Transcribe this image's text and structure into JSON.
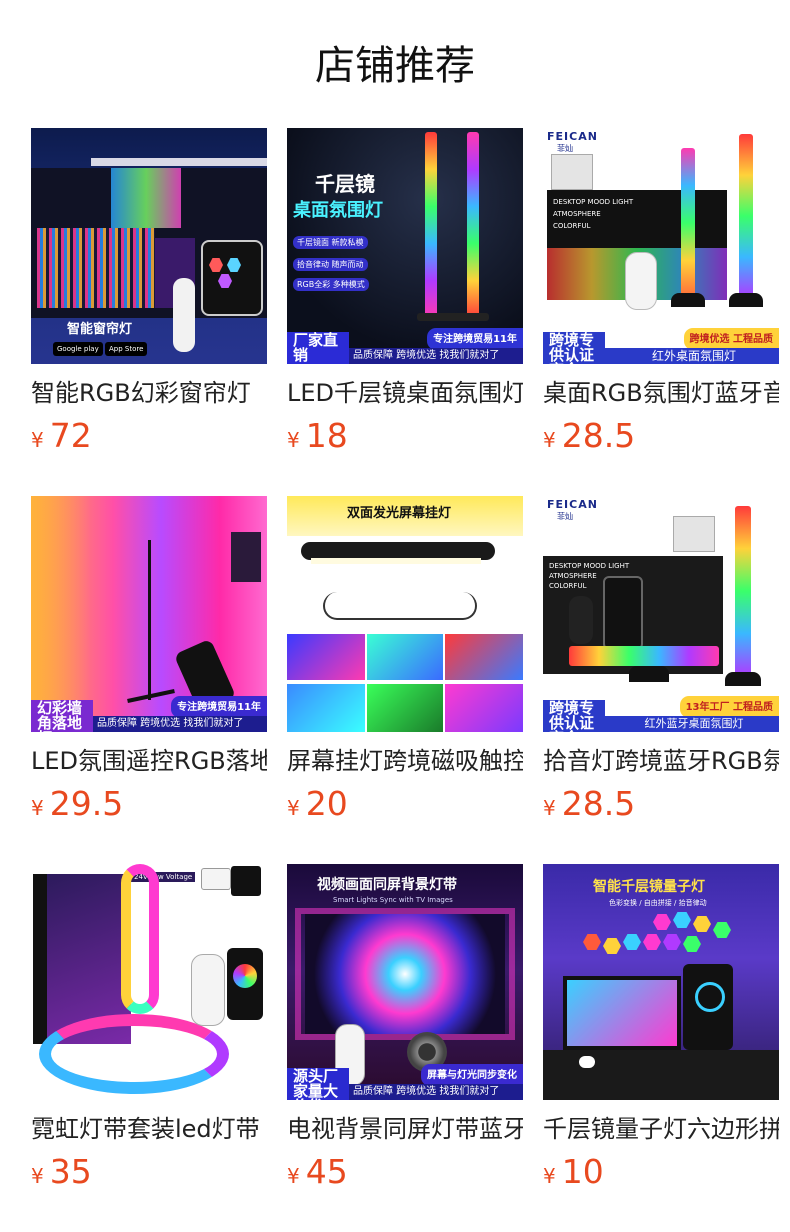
{
  "title": "店铺推荐",
  "currency": "¥",
  "products": [
    {
      "name": "智能RGB幻彩窗帘灯",
      "price": "72",
      "image_text": {
        "caption": "智能窗帘灯",
        "store1": "Google play",
        "store2": "App Store"
      }
    },
    {
      "name": "LED千层镜桌面氛围灯",
      "price": "18",
      "image_text": {
        "head1": "千层镜",
        "head2": "桌面氛围灯",
        "tag1": "千层镜面 新款私模",
        "tag2": "拾音律动 随声而动",
        "tag3": "RGB全彩 多种模式",
        "badge_left": "厂家直销",
        "badge_right": "专注跨境贸易11年",
        "strip": "品质保障 跨境优选 找我们就对了"
      }
    },
    {
      "name": "桌面RGB氛围灯蓝牙音乐",
      "price": "28.5",
      "image_text": {
        "brand": "FEICAN",
        "brand_cn": "菲灿",
        "box1": "DESKTOP MOOD LIGHT",
        "box2": "ATMOSPHERE",
        "box3": "COLORFUL",
        "badge_left": "跨境专供认证齐全",
        "badge_right": "跨境优选 工程品质",
        "strip": "红外桌面氛围灯"
      }
    },
    {
      "name": "LED氛围遥控RGB落地灯",
      "price": "29.5",
      "image_text": {
        "badge_left": "幻彩墙角落地灯",
        "badge_right": "专注跨境贸易11年",
        "strip": "品质保障 跨境优选 找我们就对了"
      }
    },
    {
      "name": "屏幕挂灯跨境磁吸触控",
      "price": "20",
      "image_text": {
        "head": "双面发光屏幕挂灯"
      }
    },
    {
      "name": "拾音灯跨境蓝牙RGB氛围",
      "price": "28.5",
      "image_text": {
        "brand": "FEICAN",
        "brand_cn": "菲灿",
        "box1": "DESKTOP MOOD LIGHT",
        "box2": "ATMOSPHERE",
        "box3": "COLORFUL",
        "badge_left": "跨境专供认证齐全",
        "badge_right": "13年工厂 工程品质",
        "strip": "红外蓝牙桌面氛围灯"
      }
    },
    {
      "name": "霓虹灯带套装led灯带",
      "price": "35",
      "image_text": {
        "box_top": "24V Low Voltage"
      }
    },
    {
      "name": "电视背景同屏灯带蓝牙",
      "price": "45",
      "image_text": {
        "head": "视频画面同屏背景灯带",
        "sub": "Smart Lights Sync with TV Images",
        "badge_left": "源头厂家量大价优",
        "badge_right": "屏幕与灯光同步变化",
        "strip": "品质保障 跨境优选 找我们就对了"
      }
    },
    {
      "name": "千层镜量子灯六边形拼接",
      "price": "10",
      "image_text": {
        "head": "智能千层镜量子灯",
        "sub": "色彩变换 / 自由拼接 / 拾音律动"
      }
    }
  ]
}
